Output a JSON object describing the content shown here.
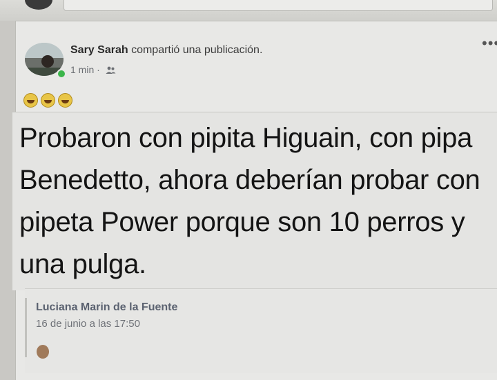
{
  "post": {
    "author": "Sary Sarah",
    "action": "compartió una publicación.",
    "time": "1 min",
    "separator": "·",
    "audience_icon": "friends-icon",
    "more": "•••",
    "emojis": [
      "grinning-face-icon",
      "grinning-face-icon",
      "grinning-face-icon"
    ]
  },
  "shared": {
    "text": "Probaron con pipita Higuain, con pipa Benedetto, ahora deberían probar con pipeta Power  porque son 10 perros y una pulga.",
    "original_author": "Luciana Marin de la Fuente",
    "original_date": "16 de junio a las 17:50"
  },
  "colors": {
    "card_bg": "#e8e8e6",
    "online": "#3bb54a",
    "emoji": "#e8c547"
  }
}
